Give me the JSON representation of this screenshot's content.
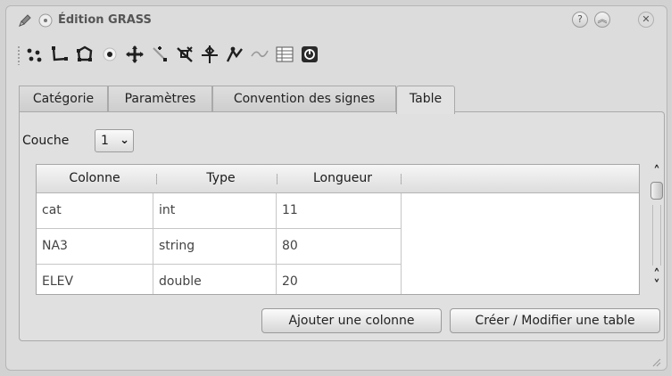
{
  "window": {
    "title": "Édition GRASS"
  },
  "titlebar_icons": {
    "app": "pencil-icon",
    "menu": "circle-dot-icon",
    "help": "help-icon",
    "shade": "chevron-up-icon",
    "close": "close-icon"
  },
  "toolbar": {
    "tools": [
      "new-point-icon",
      "new-line-icon",
      "new-boundary-icon",
      "new-centroid-icon",
      "move-vertex-icon",
      "add-vertex-icon",
      "delete-vertex-icon",
      "move-element-icon",
      "split-line-icon",
      "edit-line-icon",
      "attribute-table-icon",
      "close-edit-icon"
    ]
  },
  "tabs": [
    {
      "label": "Catégorie",
      "active": false
    },
    {
      "label": "Paramètres",
      "active": false
    },
    {
      "label": "Convention des signes",
      "active": false
    },
    {
      "label": "Table",
      "active": true
    }
  ],
  "layer": {
    "label": "Couche",
    "value": "1"
  },
  "table": {
    "columns": [
      "Colonne",
      "Type",
      "Longueur"
    ],
    "rows": [
      [
        "cat",
        "int",
        "11"
      ],
      [
        "NA3",
        "string",
        "80"
      ],
      [
        "ELEV",
        "double",
        "20"
      ]
    ]
  },
  "buttons": {
    "add_column": "Ajouter une colonne",
    "create_table": "Créer / Modifier une table"
  },
  "colors": {
    "window_bg": "#dcdcdc",
    "panel_bg": "#e0e0e0",
    "table_bg": "#ffffff",
    "tool_dark": "#1f1f1f"
  }
}
